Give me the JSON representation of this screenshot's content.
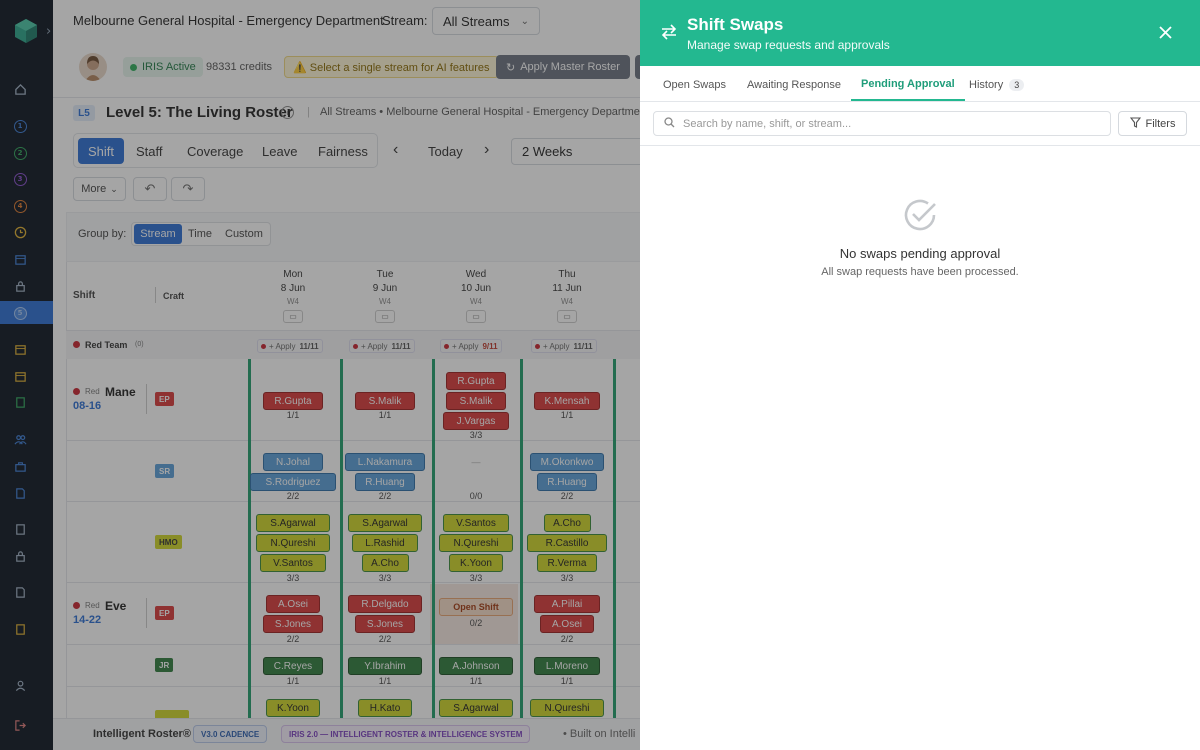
{
  "sidebar": {
    "numbers": [
      "1",
      "2",
      "3",
      "4",
      "5"
    ]
  },
  "header": {
    "title": "Melbourne General Hospital - Emergency Department",
    "stream_label": "Stream:",
    "stream_value": "All Streams"
  },
  "status": {
    "iris": "IRIS Active",
    "credits": "98331 credits",
    "warning": "⚠️ Select a single stream for AI features",
    "apply_master": "Apply Master Roster"
  },
  "level": {
    "badge": "L5",
    "title": "Level 5: The Living Roster",
    "crumb": "All Streams • Melbourne General Hospital - Emergency Department"
  },
  "views": {
    "tabs": [
      "Shift",
      "Staff",
      "Coverage",
      "Leave",
      "Fairness"
    ],
    "today": "Today",
    "range": "2 Weeks",
    "more": "More"
  },
  "groupby": {
    "label": "Group by:",
    "options": [
      "Stream",
      "Time",
      "Custom"
    ]
  },
  "grid": {
    "col_shift": "Shift",
    "col_craft": "Craft",
    "days": [
      {
        "dow": "Mon",
        "date": "8 Jun",
        "wk": "W4"
      },
      {
        "dow": "Tue",
        "date": "9 Jun",
        "wk": "W4"
      },
      {
        "dow": "Wed",
        "date": "10 Jun",
        "wk": "W4"
      },
      {
        "dow": "Thu",
        "date": "11 Jun",
        "wk": "W4"
      }
    ],
    "team": {
      "name": "Red Team",
      "count": "(0)"
    },
    "apply": [
      {
        "label": "+ Apply",
        "count": "11/11"
      },
      {
        "label": "+ Apply",
        "count": "11/11"
      },
      {
        "label": "+ Apply",
        "count": "9/11"
      },
      {
        "label": "+ Apply",
        "count": "11/11"
      }
    ],
    "shift_mane": {
      "team": "Red",
      "name": "Mane",
      "time": "08-16"
    },
    "shift_eve": {
      "team": "Red",
      "name": "Eve",
      "time": "14-22"
    },
    "crafts": {
      "ep": "EP",
      "sr": "SR",
      "hmo": "HMO",
      "ep2": "EP",
      "jr": "JR"
    },
    "rows": {
      "mane_ep": [
        {
          "names": [
            "R.Gupta"
          ],
          "frac": "1/1"
        },
        {
          "names": [
            "S.Malik"
          ],
          "frac": "1/1"
        },
        {
          "names": [
            "R.Gupta",
            "S.Malik",
            "J.Vargas"
          ],
          "frac": "3/3"
        },
        {
          "names": [
            "K.Mensah"
          ],
          "frac": "1/1"
        }
      ],
      "mane_sr": [
        {
          "names": [
            "N.Johal",
            "S.Rodriguez"
          ],
          "frac": "2/2"
        },
        {
          "names": [
            "L.Nakamura",
            "R.Huang"
          ],
          "frac": "2/2"
        },
        {
          "names": [
            "—"
          ],
          "frac": "0/0"
        },
        {
          "names": [
            "M.Okonkwo",
            "R.Huang"
          ],
          "frac": "2/2"
        }
      ],
      "mane_hmo": [
        {
          "names": [
            "S.Agarwal",
            "N.Qureshi",
            "V.Santos"
          ],
          "frac": "3/3"
        },
        {
          "names": [
            "S.Agarwal",
            "L.Rashid",
            "A.Cho"
          ],
          "frac": "3/3"
        },
        {
          "names": [
            "V.Santos",
            "N.Qureshi",
            "K.Yoon"
          ],
          "frac": "3/3"
        },
        {
          "names": [
            "A.Cho",
            "R.Castillo",
            "R.Verma"
          ],
          "frac": "3/3"
        }
      ],
      "eve_ep": [
        {
          "names": [
            "A.Osei",
            "S.Jones"
          ],
          "frac": "2/2"
        },
        {
          "names": [
            "R.Delgado",
            "S.Jones"
          ],
          "frac": "2/2"
        },
        {
          "names": [
            "Open Shift"
          ],
          "frac": "0/2"
        },
        {
          "names": [
            "A.Pillai",
            "A.Osei"
          ],
          "frac": "2/2"
        }
      ],
      "eve_jr": [
        {
          "names": [
            "C.Reyes"
          ],
          "frac": "1/1"
        },
        {
          "names": [
            "Y.Ibrahim"
          ],
          "frac": "1/1"
        },
        {
          "names": [
            "A.Johnson"
          ],
          "frac": "1/1"
        },
        {
          "names": [
            "L.Moreno"
          ],
          "frac": "1/1"
        }
      ],
      "eve_hmo": [
        {
          "names": [
            "K.Yoon"
          ]
        },
        {
          "names": [
            "H.Kato"
          ]
        },
        {
          "names": [
            "S.Agarwal"
          ]
        },
        {
          "names": [
            "N.Qureshi"
          ]
        }
      ]
    }
  },
  "footer": {
    "brand": "Intelligent Roster®",
    "version": "V3.0 CADENCE",
    "iris": "IRIS 2.0 — INTELLIGENT ROSTER & INTELLIGENCE SYSTEM",
    "built": "Built on Intelli"
  },
  "panel": {
    "title": "Shift Swaps",
    "subtitle": "Manage swap requests and approvals",
    "tabs": [
      "Open Swaps",
      "Awaiting Response",
      "Pending Approval",
      "History"
    ],
    "history_count": "3",
    "search_placeholder": "Search by name, shift, or stream...",
    "filters": "Filters",
    "empty_title": "No swaps pending approval",
    "empty_sub": "All swap requests have been processed."
  },
  "colors": {
    "accent": "#23b890",
    "primary": "#2c6fd4",
    "sidebar": "#0b1420"
  }
}
